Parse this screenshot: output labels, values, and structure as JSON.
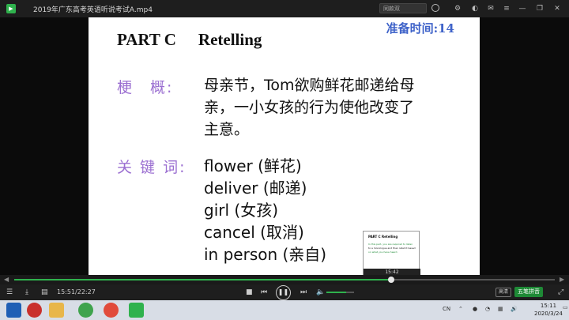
{
  "window": {
    "title": "2019年广东高考英语听说考试A.mp4",
    "search_text": "同款双"
  },
  "slide": {
    "timer": "准备时间:14",
    "part": "PART C",
    "part_sub": "Retelling",
    "summary_label": "梗　概:",
    "summary_lines": [
      "母亲节，Tom欲购鲜花邮递给母",
      "亲，一小女孩的行为使他改变了",
      "主意。"
    ],
    "keywords_label": "关 键 词:",
    "keywords": [
      "flower (鲜花)",
      "deliver (邮递)",
      "girl (女孩)",
      "cancel (取消)",
      "in person (亲自)"
    ]
  },
  "thumbnail": {
    "title": "PART C    Retelling",
    "lines": [
      "In this part, you are required to listen",
      "to a monologue and then retell it based",
      "on what you have heard."
    ],
    "time": "15:42"
  },
  "player": {
    "progress": 0.6975,
    "volume": 0.7,
    "current_time": "15:51",
    "total_time": "22:27",
    "time_display": "15:51/22:27",
    "quality_label": "高清",
    "ime_label": "五笔拼音"
  },
  "taskbar": {
    "ime_mode": "CN",
    "time": "15:11",
    "date": "2020/3/24"
  },
  "colors": {
    "accent": "#2fb24d",
    "timer": "#3f63c9",
    "label": "#9b6fd1"
  },
  "icons": [
    "app-logo-icon",
    "search-icon",
    "minimize-icon",
    "maximize-icon",
    "close-icon",
    "stop-icon",
    "prev-icon",
    "play-pause-icon",
    "next-icon",
    "volume-icon",
    "windows-start-icon"
  ]
}
